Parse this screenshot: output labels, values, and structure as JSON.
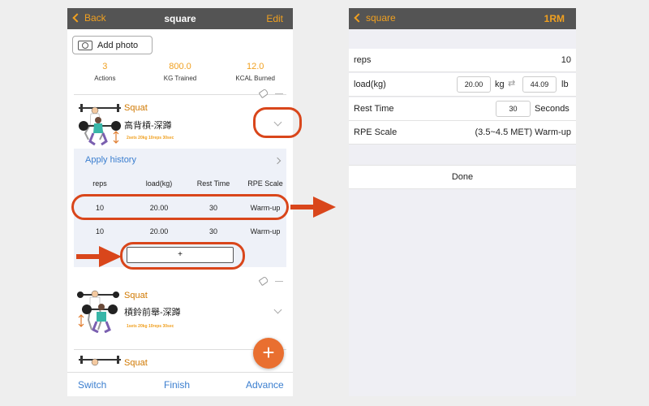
{
  "left": {
    "nav": {
      "back": "Back",
      "title": "square",
      "edit": "Edit"
    },
    "add_photo": "Add photo",
    "stats": [
      {
        "value": "3",
        "label": "Actions"
      },
      {
        "value": "800.0",
        "label": "KG Trained"
      },
      {
        "value": "12.0",
        "label": "KCAL Burned"
      }
    ],
    "exercises": [
      {
        "name": "Squat",
        "subname": "高背槓-深蹲",
        "detail": "2sets 20kg 10reps 30sec"
      },
      {
        "name": "Squat",
        "subname": "槓鈴前舉-深蹲",
        "detail": "1sets 20kg 10reps 30sec"
      },
      {
        "name": "Squat"
      }
    ],
    "history": {
      "apply": "Apply history",
      "headers": [
        "reps",
        "load(kg)",
        "Rest Time",
        "RPE Scale"
      ],
      "rows": [
        [
          "10",
          "20.00",
          "30",
          "Warm-up"
        ],
        [
          "10",
          "20.00",
          "30",
          "Warm-up"
        ]
      ],
      "add": "+"
    },
    "fab": "+",
    "tabs": [
      "Switch",
      "Finish",
      "Advance"
    ]
  },
  "right": {
    "nav": {
      "back": "square",
      "action": "1RM"
    },
    "reps": {
      "label": "reps",
      "value": "10"
    },
    "load": {
      "label": "load(kg)",
      "kg_value": "20.00",
      "kg_unit": "kg",
      "swap": "⇄",
      "lb_value": "44.09",
      "lb_unit": "lb"
    },
    "rest": {
      "label": "Rest Time",
      "value": "30",
      "unit": "Seconds"
    },
    "rpe": {
      "label": "RPE Scale",
      "value": "(3.5~4.5 MET) Warm-up"
    },
    "done": "Done"
  },
  "colors": {
    "accent": "#f0a020",
    "link": "#3a7ecf",
    "annotation": "#d9461b",
    "navbar": "#545454"
  }
}
